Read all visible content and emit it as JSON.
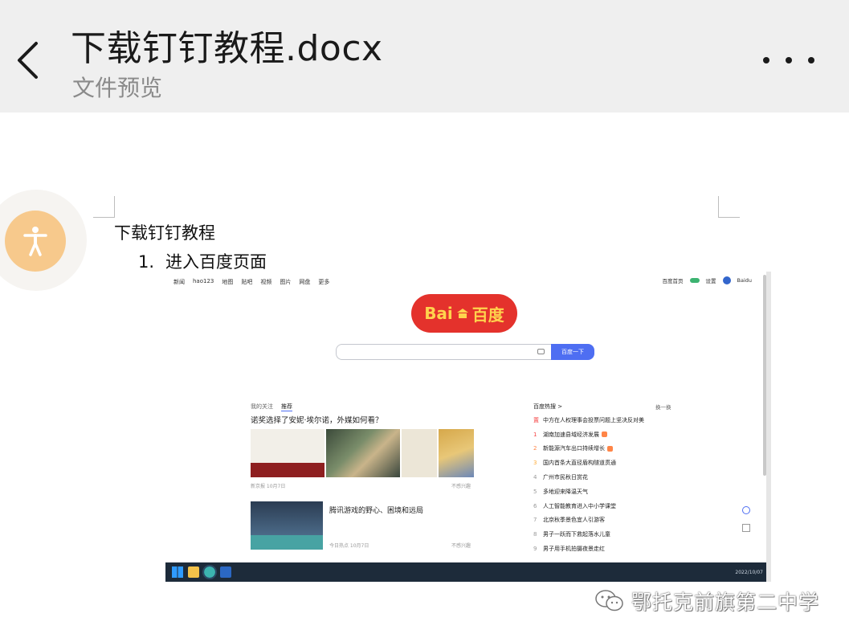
{
  "header": {
    "back_icon": "chevron-left-icon",
    "title": "下载钉钉教程.docx",
    "subtitle": "文件预览",
    "more_icon": "more-dots-icon"
  },
  "accessibility": {
    "icon": "accessibility-person-icon",
    "color": "#f7c98c"
  },
  "document": {
    "heading": "下载钉钉教程",
    "list": [
      {
        "number": "1.",
        "text": "进入百度页面"
      }
    ]
  },
  "screenshot": {
    "nav": [
      "新闻",
      "hao123",
      "地图",
      "贴吧",
      "视频",
      "图片",
      "网盘",
      "更多"
    ],
    "right_links": [
      "百度首页",
      "设置",
      "Baidu"
    ],
    "logo_left": "Bai",
    "logo_right": "百度",
    "search_button": "百度一下",
    "tabs": [
      "我的关注",
      "推荐"
    ],
    "headline": "诺奖选择了安妮·埃尔诺，外媒如何看？",
    "card2_title": "腾讯游戏的野心、困境和远局",
    "hot_title": "百度热搜 >",
    "hot_swap": "换一换",
    "hot_list": [
      "中方在人权理事会投票问题上坚决反对美",
      "湖南加速县域经济发展",
      "新能源汽车出口持续增长",
      "国内首条大直径盾构隧道贯通",
      "广州市民秋日赏花",
      "多地迎来降温天气",
      "人工智能教育进入中小学课堂",
      "北京秋季景色宜人引游客",
      "男子一跃而下救起落水儿童",
      "男子用手机拍摄夜景走红"
    ],
    "hot_ranks": [
      "置",
      "1",
      "2",
      "3",
      "4",
      "5",
      "6",
      "7",
      "8",
      "9"
    ],
    "meta1": "新京报 10月7日",
    "meta1_right": "不感兴趣",
    "meta2": "今日热点 10月7日",
    "meta2_right": "不感兴趣",
    "tray": "2022/10/07"
  },
  "watermark": {
    "icon": "wechat-icon",
    "text": "鄂托克前旗第二中学"
  }
}
